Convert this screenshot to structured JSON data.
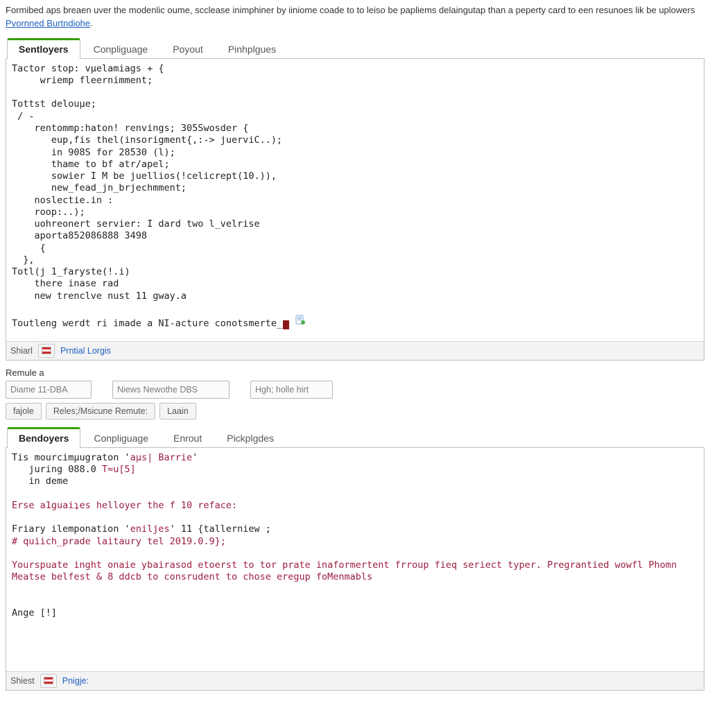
{
  "intro": {
    "text_before_link": "Formibed aps breaen uver the modenlic oume, scclease inimphiner by iiniome coade to to leiso be papliems delaingutap than a peperty card to een resunoes lik be uplowers ",
    "link_text": "Pvornned Burtndiohe",
    "link_after": "."
  },
  "top_tabs": [
    {
      "label": "Sentloyers",
      "active": true
    },
    {
      "label": "Conpliguage",
      "active": false
    },
    {
      "label": "Poyout",
      "active": false
    },
    {
      "label": "Pinhplgues",
      "active": false
    }
  ],
  "top_code": {
    "lines": [
      "Tactor stop: vμelamiags + {",
      "     wriemp fleernimment;",
      "",
      "Tottst delouμe;",
      " / -",
      "    rentommp:haton! renvings; 305Swosder {",
      "       eup,fis thel(insorigment{,:-> juerviC..);",
      "       in 908S for 28530 (l);",
      "       thame to bf atr/apel;",
      "       sowier I M be juellios(!celicrept(10.)),",
      "       new_fead_jn_brjechmment;",
      "    noslectie.in :",
      "    roop:..);",
      "    uohreonert servier: I dard two l_velrise",
      "    aporta852086888 3498",
      "     {",
      "  },",
      "Totl(j 1_faryste(!.i)",
      "    there inase rad",
      "    new trenclve nust 11 gway.a",
      "",
      "Toutleng werdt ri imade a NI-acture conotsmerte_"
    ]
  },
  "top_status": {
    "left": "Shiarl",
    "link": "Prntial Lorgis"
  },
  "middle": {
    "section_label": "Remule a",
    "inputs": {
      "a": "Diame 11-DBA",
      "b": "Niews Newothe DBS",
      "c": "Hgh; holle hirt"
    },
    "buttons": {
      "a": "fajole",
      "b": "Reles;/Msicune Remute:",
      "c": "Laain"
    }
  },
  "bottom_tabs": [
    {
      "label": "Bendoyers",
      "active": true
    },
    {
      "label": "Conpliguage",
      "active": false
    },
    {
      "label": "Enrout",
      "active": false
    },
    {
      "label": "Pickplgdes",
      "active": false
    }
  ],
  "bottom_code": {
    "line1_a": "Tis mourcimμugraton '",
    "line1_b": "aμs| Barrie",
    "line1_c": "'",
    "line2_a": "   juring 088.0 ",
    "line2_b": "T≈u[5]",
    "line3": "   in deme",
    "line5": "Erse a1guaiʇes helloyer the f 10 reface:",
    "line7_a": "Friary ilemponation '",
    "line7_b": "eniljes",
    "line7_c": "' 11 {tallerniew ;",
    "line8": "# quiich_prade laitaury tel 2019.0.9};",
    "line10": "Yourspuate inght onaie ybairasod etoerst to tor prate inaformertent frroup fieq seriect typer. Pregrantied wowfl Phomn",
    "line11": "Meatse belfest & 8 ddcb to consrudent to chose eregup foMenmabls",
    "line14": "Ange [!]"
  },
  "bottom_status": {
    "left": "Shiest",
    "link": "Pnigje:"
  }
}
